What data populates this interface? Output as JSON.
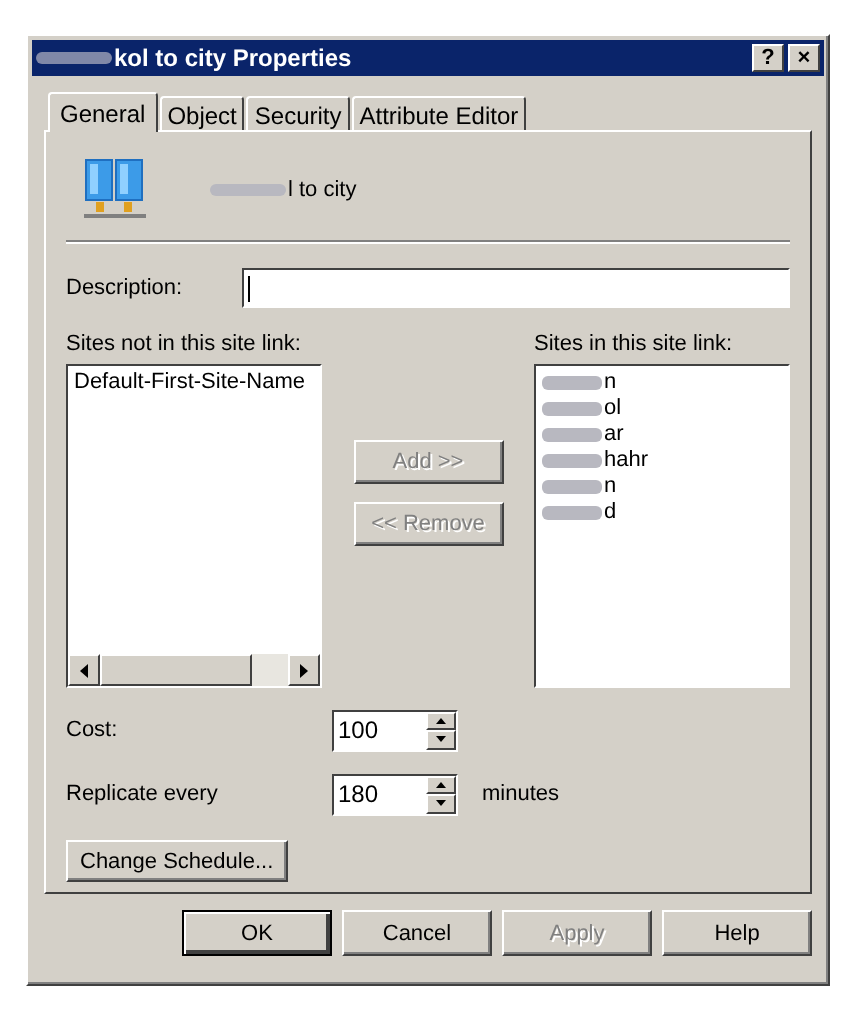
{
  "window": {
    "title": "kol to city Properties",
    "title_buttons": [
      "?",
      "×"
    ]
  },
  "tabs": [
    {
      "label": "General",
      "selected": true
    },
    {
      "label": "Object",
      "selected": false
    },
    {
      "label": "Security",
      "selected": false
    },
    {
      "label": "Attribute Editor",
      "selected": false
    }
  ],
  "object_name": "l to city",
  "description": {
    "label": "Description:"
  },
  "sites_not_in": {
    "label": "Sites not in this site link:",
    "items": [
      "Default-First-Site-Name"
    ]
  },
  "sites_in": {
    "label": "Sites in this site link:",
    "items": [
      "n",
      "ol",
      "ar",
      "hahr",
      "n",
      "d"
    ]
  },
  "move_buttons": [
    {
      "label": "Add >>",
      "disabled": true
    },
    {
      "label": "<< Remove",
      "disabled": true
    }
  ],
  "cost": {
    "label": "Cost:",
    "value": "100"
  },
  "replicate": {
    "label": "Replicate every",
    "value": "180",
    "unit": "minutes"
  },
  "schedule_button": "Change Schedule...",
  "buttons": [
    {
      "label": "OK",
      "disabled": false,
      "default": true
    },
    {
      "label": "Cancel",
      "disabled": false,
      "default": false
    },
    {
      "label": "Apply",
      "disabled": true,
      "default": false
    },
    {
      "label": "Help",
      "disabled": false,
      "default": false
    }
  ]
}
